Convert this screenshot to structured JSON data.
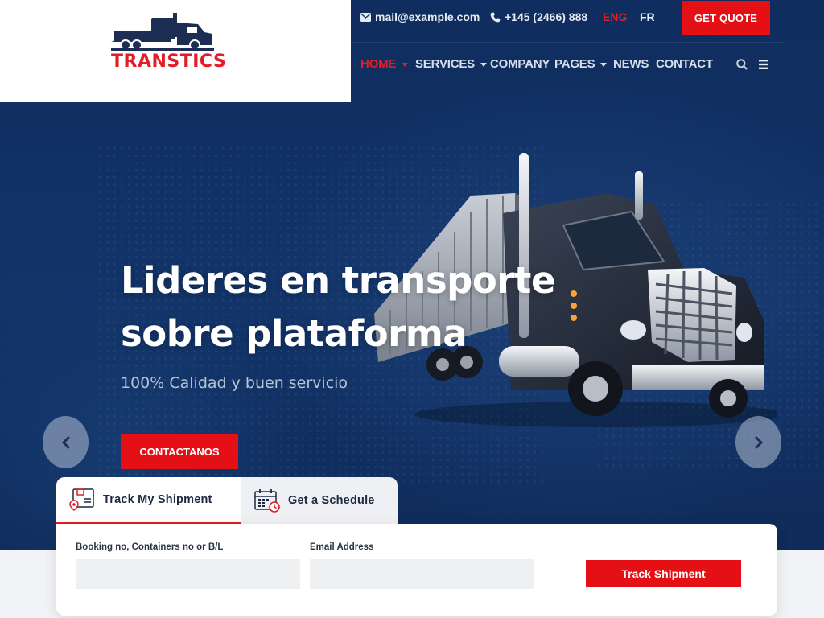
{
  "brand": {
    "name": "TRANSTICS",
    "accent": "#e21d25",
    "navy": "#123469"
  },
  "topbar": {
    "email": "mail@example.com",
    "phone": "+145 (2466) 888",
    "languages": [
      "ENG",
      "FR"
    ],
    "active_language": "ENG",
    "quote_label": "GET QUOTE",
    "icons": [
      "envelope-icon",
      "phone-icon"
    ]
  },
  "nav": {
    "items": [
      {
        "label": "HOME",
        "active": true,
        "dropdown": true
      },
      {
        "label": "SERVICES",
        "active": false,
        "dropdown": true
      },
      {
        "label": "COMPANY",
        "active": false,
        "dropdown": false
      },
      {
        "label": "PAGES",
        "active": false,
        "dropdown": true
      },
      {
        "label": "NEWS",
        "active": false,
        "dropdown": false
      },
      {
        "label": "CONTACT",
        "active": false,
        "dropdown": false
      }
    ],
    "icons": [
      "search-icon",
      "menu-icon"
    ]
  },
  "hero": {
    "title_line1": "Lideres en transporte",
    "title_line2": "sobre plataforma",
    "subtitle": "100% Calidad y buen servicio",
    "cta_label": "CONTACTANOS",
    "prev_icon": "chevron-left-icon",
    "next_icon": "chevron-right-icon"
  },
  "tracking": {
    "tabs": [
      {
        "label": "Track My Shipment",
        "icon": "shipment-icon",
        "active": true
      },
      {
        "label": "Get a Schedule",
        "icon": "calendar-icon",
        "active": false
      }
    ],
    "fields": [
      {
        "label": "Booking no, Containers no or B/L",
        "value": "",
        "placeholder": ""
      },
      {
        "label": "Email Address",
        "value": "",
        "placeholder": ""
      }
    ],
    "submit_label": "Track Shipment"
  }
}
